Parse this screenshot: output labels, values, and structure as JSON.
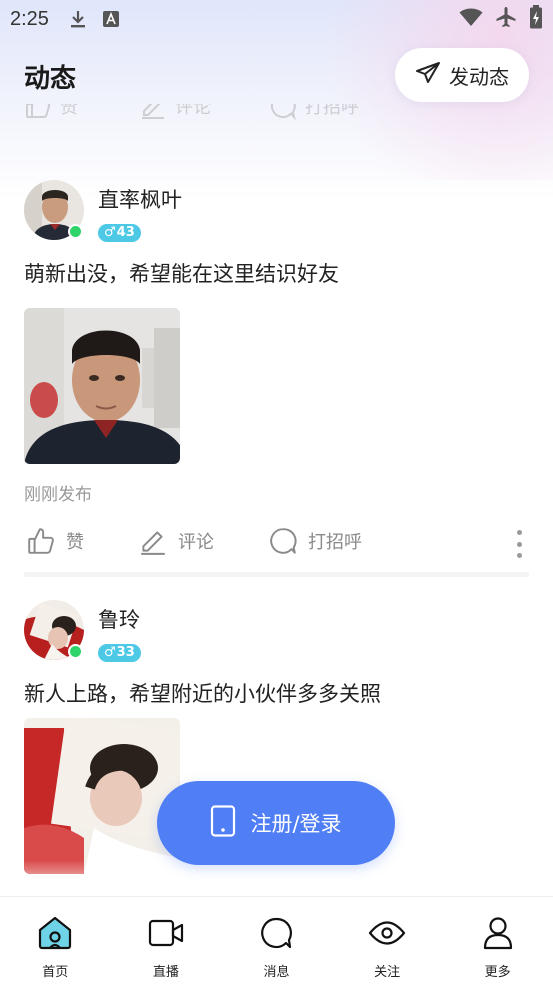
{
  "status_bar": {
    "time": "2:25"
  },
  "header": {
    "title": "动态",
    "post_button_label": "发动态"
  },
  "faded_actions": {
    "like": "赞",
    "comment": "评论",
    "greet": "打招呼"
  },
  "posts": [
    {
      "username": "直率枫叶",
      "gender_symbol": "♂",
      "age": "43",
      "text": "萌新出没，希望能在这里结识好友",
      "time": "刚刚发布",
      "actions": {
        "like": "赞",
        "comment": "评论",
        "greet": "打招呼"
      }
    },
    {
      "username": "鲁玲",
      "gender_symbol": "♂",
      "age": "33",
      "text": "新人上路，希望附近的小伙伴多多关照"
    }
  ],
  "login_button": {
    "label": "注册/登录"
  },
  "tabbar": {
    "items": [
      {
        "label": "首页",
        "icon": "home-icon"
      },
      {
        "label": "直播",
        "icon": "video-camera-icon"
      },
      {
        "label": "消息",
        "icon": "chat-bubble-icon"
      },
      {
        "label": "关注",
        "icon": "eye-icon"
      },
      {
        "label": "更多",
        "icon": "user-icon"
      }
    ]
  },
  "colors": {
    "accent": "#4f7ef5",
    "badge": "#4dc9e6",
    "online": "#2ed36a",
    "tab_active_fill": "#6fd3e8"
  }
}
